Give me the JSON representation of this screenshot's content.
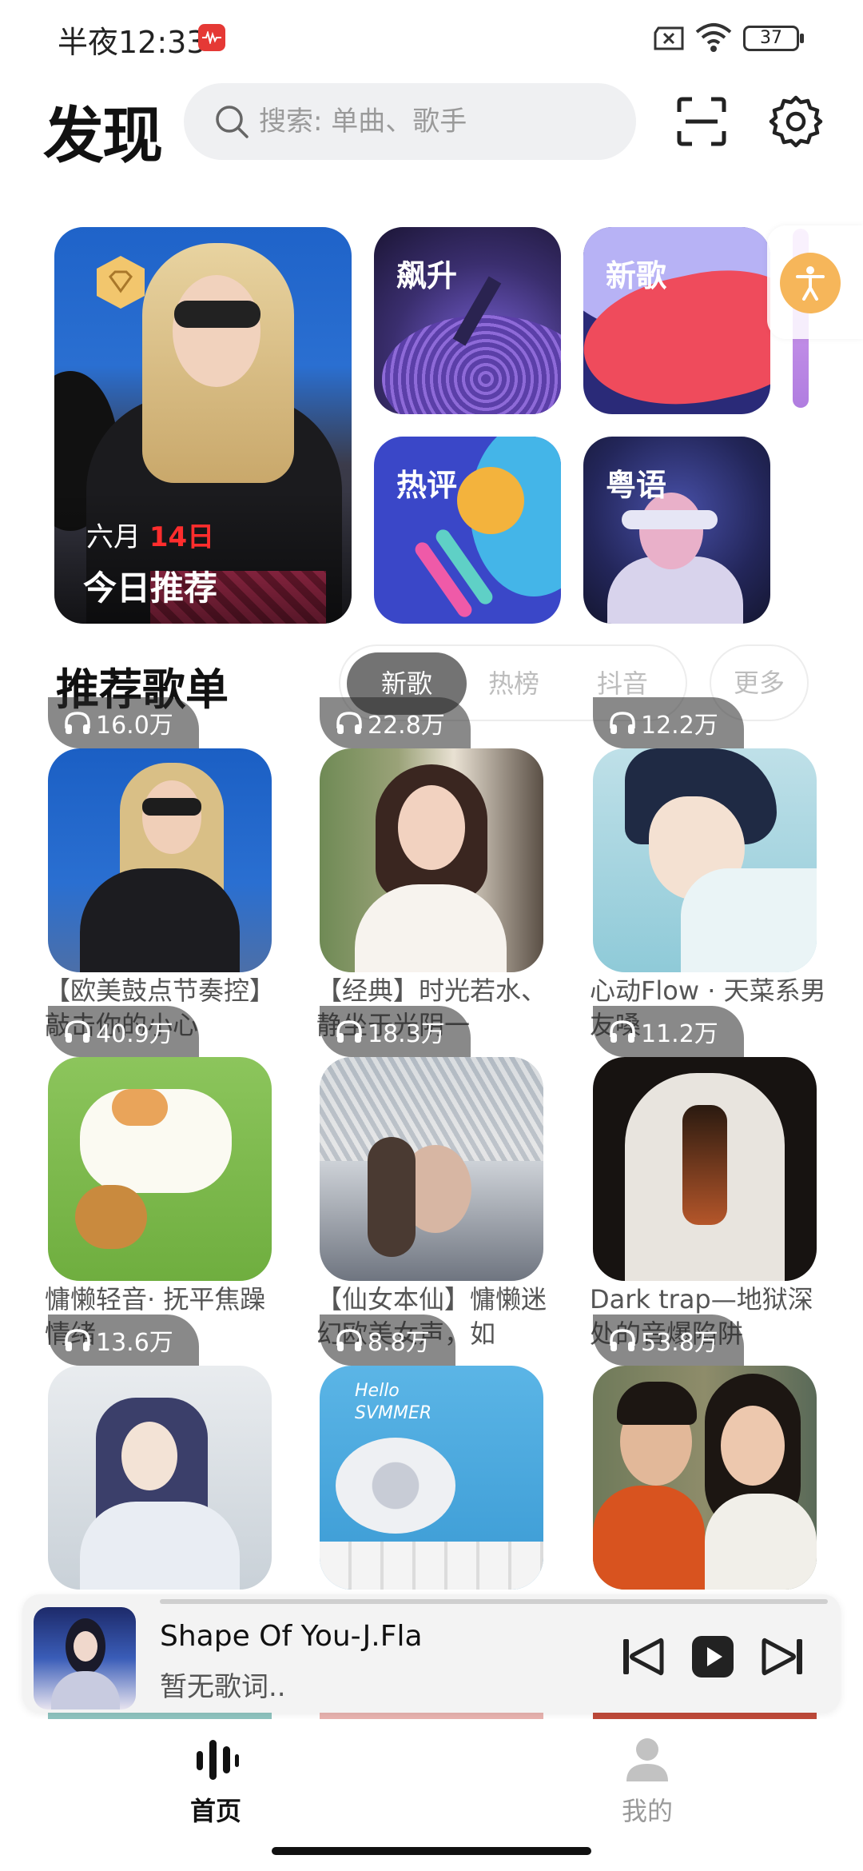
{
  "status_bar": {
    "time": "半夜12:33",
    "battery": "37"
  },
  "header": {
    "title": "发现",
    "search_placeholder": "搜索: 单曲、歌手"
  },
  "feature_cards": {
    "today": {
      "month": "六月",
      "day": "14日",
      "title": "今日推荐"
    },
    "rise": {
      "label": "飙升"
    },
    "new": {
      "label": "新歌"
    },
    "hot_comments": {
      "label": "热评"
    },
    "cantonese": {
      "label": "粤语"
    }
  },
  "section": {
    "title": "推荐歌单",
    "tabs": [
      "新歌",
      "热榜",
      "抖音"
    ],
    "active_tab": "新歌",
    "more_label": "更多"
  },
  "playlists": [
    {
      "count": "16.0万",
      "title": "【欧美鼓点节奏控】敲击你的小心"
    },
    {
      "count": "22.8万",
      "title": "【经典】时光若水、静坐于光阴一"
    },
    {
      "count": "12.2万",
      "title": "心动Flow · 天菜系男友嗓"
    },
    {
      "count": "40.9万",
      "title": "慵懒轻音· 抚平焦躁情绪"
    },
    {
      "count": "18.3万",
      "title": "【仙女本仙】慵懒迷幻欧美女声，如"
    },
    {
      "count": "11.2万",
      "title": "Dark trap—地狱深处的音爆陷阱"
    },
    {
      "count": "13.6万",
      "title": ""
    },
    {
      "count": "8.8万",
      "title": ""
    },
    {
      "count": "53.8万",
      "title": ""
    }
  ],
  "cover_text": {
    "summer": "Hello SVMMER"
  },
  "mini_player": {
    "title": "Shape Of You-J.Fla",
    "lyric": "暂无歌词.."
  },
  "bottom_nav": {
    "home": "首页",
    "mine": "我的"
  },
  "colors": {
    "active_tab": "#737373",
    "accent_red": "#ff2d2d"
  }
}
